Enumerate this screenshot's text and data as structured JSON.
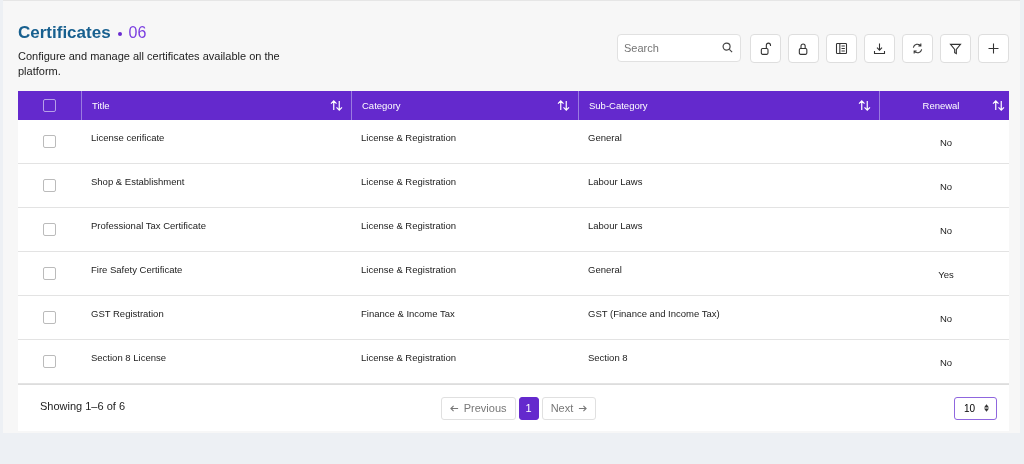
{
  "header": {
    "title": "Certificates",
    "count": "06",
    "description": "Configure and manage all certificates available on the platform."
  },
  "toolbar": {
    "search": {
      "placeholder": "Search"
    },
    "buttons": [
      {
        "kind": "unlock"
      },
      {
        "kind": "lock"
      },
      {
        "kind": "columns"
      },
      {
        "kind": "download"
      },
      {
        "kind": "refresh"
      },
      {
        "kind": "filter"
      },
      {
        "kind": "add"
      }
    ]
  },
  "table": {
    "select_all": {
      "checked": false
    },
    "columns": [
      {
        "label": "Title"
      },
      {
        "label": "Category"
      },
      {
        "label": "Sub-Category"
      },
      {
        "label": "Renewal"
      }
    ],
    "rows": [
      {
        "checked": false,
        "cells": [
          "License cerificate",
          "License & Registration",
          "General",
          "No"
        ]
      },
      {
        "checked": false,
        "cells": [
          "Shop & Establishment",
          "License & Registration",
          "Labour Laws",
          "No"
        ]
      },
      {
        "checked": false,
        "cells": [
          "Professional Tax Certificate",
          "License & Registration",
          "Labour Laws",
          "No"
        ]
      },
      {
        "checked": false,
        "cells": [
          "Fire Safety Certificate",
          "License & Registration",
          "General",
          "Yes"
        ]
      },
      {
        "checked": false,
        "cells": [
          "GST Registration",
          "Finance & Income Tax",
          "GST (Finance and Income Tax)",
          "No"
        ]
      },
      {
        "checked": false,
        "cells": [
          "Section 8 License",
          "License & Registration",
          "Section 8",
          "No"
        ]
      }
    ]
  },
  "footer": {
    "summary": "Showing 1–6 of 6",
    "previous": {
      "label": "Previous",
      "disabled": true
    },
    "pages": [
      {
        "label": "1",
        "selected": true
      }
    ],
    "next": {
      "label": "Next",
      "disabled": true
    },
    "page_size": "10"
  }
}
